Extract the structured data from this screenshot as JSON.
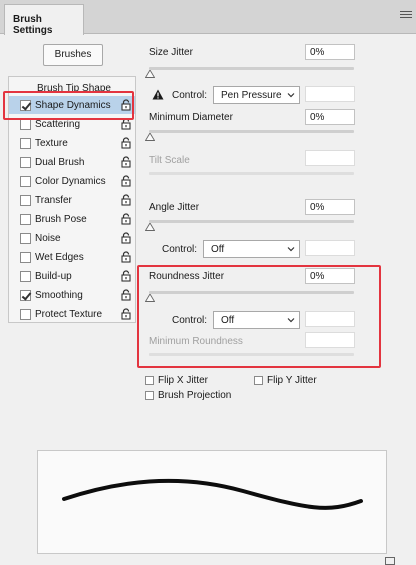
{
  "panel": {
    "tab_title": "Brush Settings"
  },
  "brushes_button": "Brushes",
  "brush_list": {
    "header": "Brush Tip Shape",
    "items": [
      {
        "label": "Shape Dynamics",
        "checked": true,
        "selected": true
      },
      {
        "label": "Scattering",
        "checked": false
      },
      {
        "label": "Texture",
        "checked": false
      },
      {
        "label": "Dual Brush",
        "checked": false
      },
      {
        "label": "Color Dynamics",
        "checked": false
      },
      {
        "label": "Transfer",
        "checked": false
      },
      {
        "label": "Brush Pose",
        "checked": false
      },
      {
        "label": "Noise",
        "checked": false
      },
      {
        "label": "Wet Edges",
        "checked": false
      },
      {
        "label": "Build-up",
        "checked": false
      },
      {
        "label": "Smoothing",
        "checked": true
      },
      {
        "label": "Protect Texture",
        "checked": false
      }
    ]
  },
  "settings": {
    "size_jitter": {
      "label": "Size Jitter",
      "value": "0%"
    },
    "size_control": {
      "label": "Control:",
      "value": "Pen Pressure"
    },
    "minimum_diameter": {
      "label": "Minimum Diameter",
      "value": "0%"
    },
    "tilt_scale": {
      "label": "Tilt Scale"
    },
    "angle_jitter": {
      "label": "Angle Jitter",
      "value": "0%"
    },
    "angle_control": {
      "label": "Control:",
      "value": "Off"
    },
    "roundness_jitter": {
      "label": "Roundness Jitter",
      "value": "0%"
    },
    "roundness_control": {
      "label": "Control:",
      "value": "Off"
    },
    "minimum_roundness": {
      "label": "Minimum Roundness"
    }
  },
  "options": {
    "flip_x": "Flip X Jitter",
    "flip_y": "Flip Y Jitter",
    "brush_projection": "Brush Projection"
  },
  "colors": {
    "highlight_box": "#e3343f",
    "selected_row": "#b9d2ea"
  },
  "icons": [
    "menu-icon",
    "lock-icon",
    "warning-icon",
    "chevron-down-icon",
    "slider-thumb-icon"
  ]
}
